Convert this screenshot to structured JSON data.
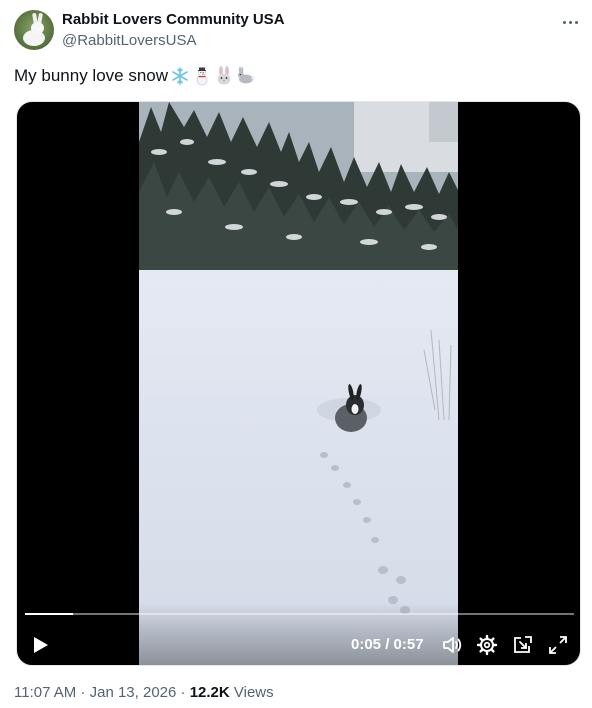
{
  "author": {
    "display_name": "Rabbit Lovers Community USA",
    "handle": "@RabbitLoversUSA",
    "avatar_icon": "white-rabbit-avatar"
  },
  "post": {
    "text": "My bunny love snow",
    "emojis": [
      "snowflake",
      "snowman",
      "rabbit-face",
      "rabbit"
    ]
  },
  "video": {
    "current_time": "0:05",
    "separator": " / ",
    "duration": "0:57",
    "progress": 0.088
  },
  "meta": {
    "time": "11:07 AM",
    "dot1": " · ",
    "date": "Jan 13, 2026",
    "dot2": " · ",
    "views_count": "12.2K",
    "views_label": " Views"
  },
  "colors": {
    "text": "#0f1419",
    "muted": "#536471",
    "video_bg": "#000000"
  }
}
